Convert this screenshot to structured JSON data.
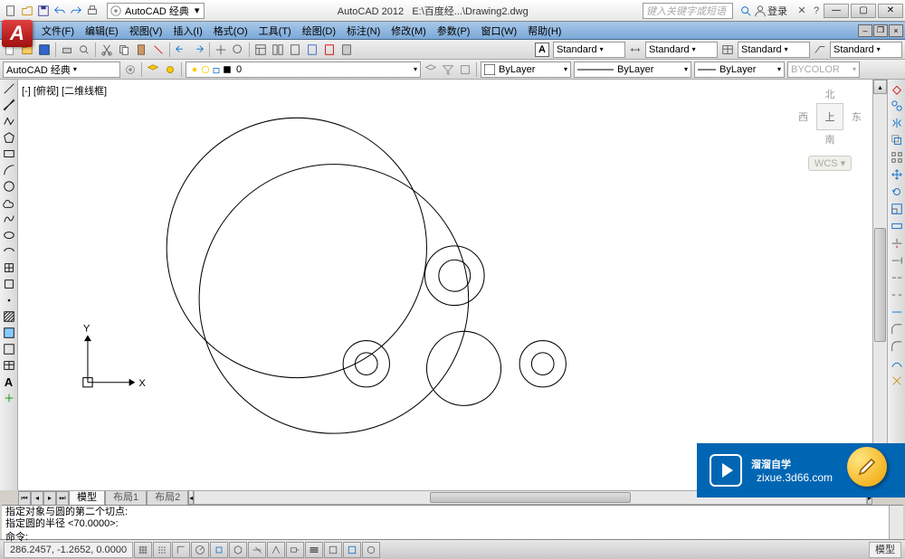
{
  "title_app": "AutoCAD 2012",
  "title_file": "E:\\百度经...\\Drawing2.dwg",
  "search_placeholder": "键入关键字或短语",
  "login_text": "登录",
  "workspace": "AutoCAD 经典",
  "menus": [
    "文件(F)",
    "编辑(E)",
    "视图(V)",
    "插入(I)",
    "格式(O)",
    "工具(T)",
    "绘图(D)",
    "标注(N)",
    "修改(M)",
    "参数(P)",
    "窗口(W)",
    "帮助(H)"
  ],
  "style_dropdowns": {
    "s1": "Standard",
    "s2": "Standard",
    "s3": "Standard",
    "s4": "Standard"
  },
  "layer_zero": "0",
  "props": {
    "bylayer1": "ByLayer",
    "bylayer2": "ByLayer",
    "bylayer3": "ByLayer",
    "bycolor": "BYCOLOR"
  },
  "view_label": "[-] [俯视] [二维线框]",
  "viewcube": {
    "n": "北",
    "s": "南",
    "e": "东",
    "w": "西",
    "top": "上",
    "wcs": "WCS"
  },
  "tabs": {
    "model": "模型",
    "layout1": "布局1",
    "layout2": "布局2"
  },
  "cmd": {
    "l1": "指定对象与圆的第二个切点:",
    "l2": "指定圆的半径 <70.0000>:",
    "prompt": "命令:"
  },
  "coords": "286.2457, -1.2652, 0.0000",
  "status_model": "模型",
  "axis": {
    "x": "X",
    "y": "Y"
  },
  "ws_label2": "AutoCAD 经典",
  "brand": {
    "name": "溜溜自学",
    "url": "zixue.3d66.com"
  }
}
